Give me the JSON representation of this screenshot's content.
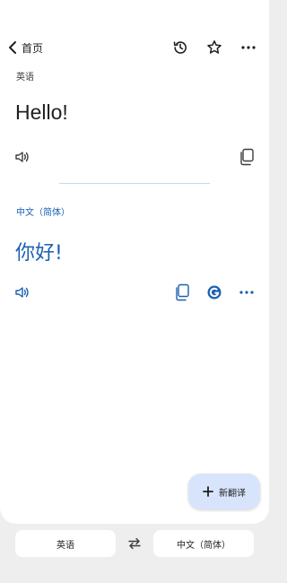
{
  "header": {
    "back_label": "首页"
  },
  "source": {
    "language": "英语",
    "text": "Hello!"
  },
  "target": {
    "language": "中文（简体）",
    "text": "你好!"
  },
  "fab": {
    "label": "新翻译"
  },
  "bottom_bar": {
    "source_language": "英语",
    "target_language": "中文（简体）"
  },
  "colors": {
    "accent": "#1a5fb4",
    "fab_background": "#d8e4fb",
    "page_background": "#eeeeee"
  },
  "icons": [
    "chevron-left-icon",
    "history-icon",
    "star-icon",
    "more-icon",
    "speaker-icon",
    "copy-icon",
    "google-g-icon",
    "plus-icon",
    "swap-icon"
  ]
}
